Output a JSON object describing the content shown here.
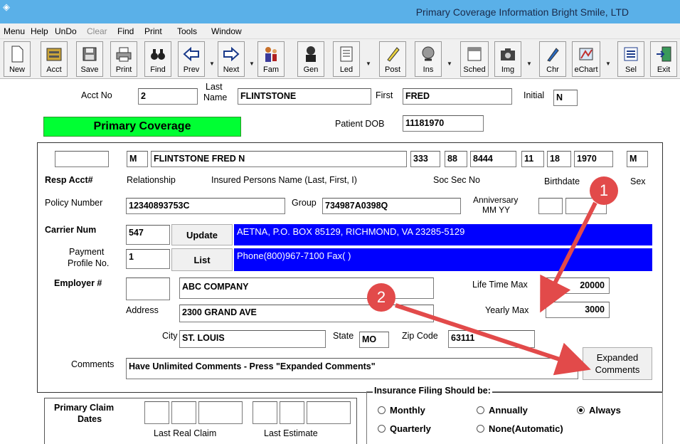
{
  "window": {
    "title": "Primary Coverage Information Bright Smile, LTD"
  },
  "menu": [
    "Menu",
    "Help",
    "UnDo",
    "Clear",
    "Find",
    "Print",
    "Tools",
    "Window"
  ],
  "toolbar": {
    "new": "New",
    "acct": "Acct",
    "save": "Save",
    "print": "Print",
    "find": "Find",
    "prev": "Prev",
    "next": "Next",
    "fam": "Fam",
    "gen": "Gen",
    "led": "Led",
    "post": "Post",
    "ins": "Ins",
    "sched": "Sched",
    "img": "Img",
    "chr": "Chr",
    "echart": "eChart",
    "sel": "Sel",
    "exit": "Exit"
  },
  "header": {
    "acct_no_label": "Acct No",
    "acct_no": "2",
    "last_label": "Last",
    "name_label": "Name",
    "last_name": "FLINTSTONE",
    "first_label": "First",
    "first_name": "FRED",
    "initial_label": "Initial",
    "initial": "N",
    "section_title": "Primary Coverage",
    "dob_label": "Patient DOB",
    "dob": "11181970"
  },
  "insured": {
    "resp_acct": "",
    "relationship": "M",
    "name": "FLINTSTONE FRED N",
    "ssn1": "333",
    "ssn2": "88",
    "ssn3": "8444",
    "bmonth": "11",
    "bday": "18",
    "byear": "1970",
    "sex": "M",
    "resp_acct_label": "Resp Acct#",
    "relationship_label": "Relationship",
    "name_label": "Insured Persons Name (Last, First, I)",
    "ssn_label": "Soc Sec No",
    "birthdate_label": "Birthdate",
    "sex_label": "Sex"
  },
  "policy": {
    "policy_label": "Policy Number",
    "policy_number": "12340893753C",
    "group_label": "Group",
    "group": "734987A0398Q",
    "anniversary_label_1": "Anniversary",
    "anniversary_label_2": "MM YY",
    "anniv_mm": "",
    "anniv_yy": ""
  },
  "carrier": {
    "label": "Carrier Num",
    "num": "547",
    "update_button": "Update",
    "address": "AETNA, P.O. BOX 85129, RICHMOND, VA 23285-5129",
    "payment_label_1": "Payment",
    "payment_label_2": "Profile No.",
    "payment_profile": "1",
    "list_button": "List",
    "phone": "Phone(800)967-7100 Fax(  )"
  },
  "employer": {
    "label": "Employer #",
    "num": "",
    "name": "ABC COMPANY",
    "address_label": "Address",
    "address": "2300 GRAND AVE",
    "city_label": "City",
    "city": "ST. LOUIS",
    "state_label": "State",
    "state": "MO",
    "zip_label": "Zip Code",
    "zip": "63111",
    "lifetime_label": "Life Time Max",
    "lifetime_max": "20000",
    "yearly_label": "Yearly Max",
    "yearly_max": "3000"
  },
  "comments": {
    "label": "Comments",
    "text": "Have Unlimited Comments - Press \"Expanded Comments\"",
    "expanded_1": "Expanded",
    "expanded_2": "Comments"
  },
  "claims": {
    "title_1": "Primary Claim",
    "title_2": "Dates",
    "last_real_label": "Last Real Claim",
    "last_estimate_label": "Last Estimate"
  },
  "filing": {
    "title": "Insurance Filing Should be:",
    "options": [
      "Monthly",
      "Annually",
      "Always",
      "Quarterly",
      "None(Automatic)"
    ],
    "selected": "Always"
  },
  "callouts": [
    "1",
    "2"
  ],
  "colors": {
    "titlebar": "#5ab0e8",
    "green_header": "#00ff33",
    "carrier_blue": "#0000ff",
    "callout_red": "#e24a4a"
  }
}
